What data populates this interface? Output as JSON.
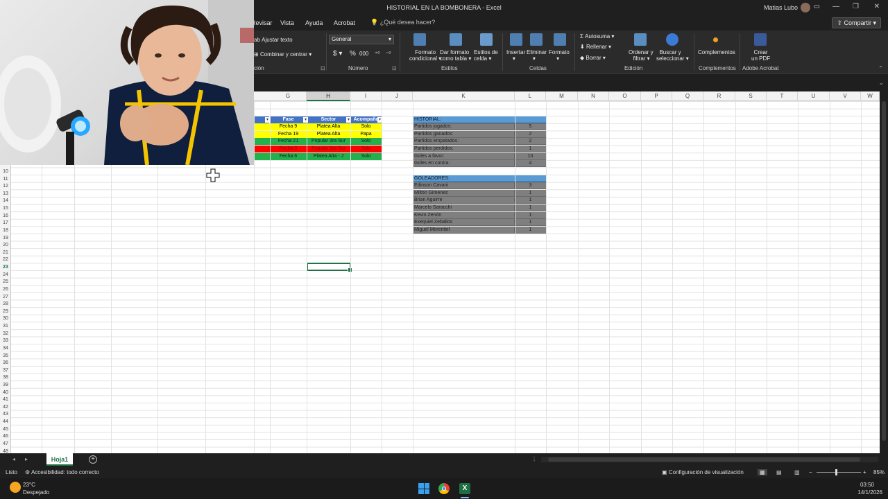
{
  "window": {
    "title": "HISTORIAL EN LA BOMBONERA  -  Excel",
    "user": "Matias Lubo"
  },
  "menu": {
    "items": [
      "Revisar",
      "Vista",
      "Ayuda",
      "Acrobat"
    ],
    "search_placeholder": "¿Qué desea hacer?",
    "share": "Compartir"
  },
  "ribbon": {
    "wrap_text": "Ajustar texto",
    "merge_center": "Combinar y centrar",
    "alignment_group_partial": "ción",
    "number_format": "General",
    "number_group": "Número",
    "styles": {
      "conditional": [
        "Formato",
        "condicional"
      ],
      "as_table": [
        "Dar formato",
        "como tabla"
      ],
      "cell_styles": [
        "Estilos de",
        "celda"
      ],
      "group": "Estilos"
    },
    "cells": {
      "insert": "Insertar",
      "delete": "Eliminar",
      "format": "Formato",
      "group": "Celdas"
    },
    "editing": {
      "autosum": "Autosuma",
      "fill": "Rellenar",
      "clear": "Borrar",
      "sort": [
        "Ordenar y",
        "filtrar"
      ],
      "find": [
        "Buscar y",
        "seleccionar"
      ],
      "group": "Edición"
    },
    "addins": {
      "label": "Complementos",
      "group": "Complementos"
    },
    "acrobat": {
      "label": [
        "Crear",
        "un PDF"
      ],
      "group": "Adobe Acrobat"
    }
  },
  "columns": [
    "G",
    "H",
    "I",
    "J",
    "K",
    "L",
    "M",
    "N",
    "O",
    "P",
    "Q",
    "R",
    "S",
    "T",
    "U",
    "V",
    "W"
  ],
  "selected_column": "H",
  "rows": {
    "first_visible": 10,
    "last_visible": 48,
    "selected": 23
  },
  "table": {
    "headers": [
      "Fase",
      "Sector",
      "Acompaña"
    ],
    "rows": [
      {
        "fase": "Fecha 9",
        "sector": "Platea Alta",
        "acomp": "Solo",
        "color": "#ffff00"
      },
      {
        "fase": "Fecha 19",
        "sector": "Platea Alta",
        "acomp": "Papa",
        "color": "#ffff00"
      },
      {
        "fase": "Fecha 21",
        "sector": "Popular 3ra Sur",
        "acomp": "Solo",
        "color": "#22b14c"
      },
      {
        "fase": "Fecha 3",
        "sector": "Popular 3ra Sur",
        "acomp": "Solo",
        "color": "#ff0000"
      },
      {
        "fase": "Fecha 6",
        "sector": "Platea Alta - J",
        "acomp": "Solo",
        "color": "#22b14c"
      }
    ]
  },
  "historial": {
    "title": "HISTORIAL:",
    "rows": [
      {
        "label": "Partidos jugados:",
        "value": "5"
      },
      {
        "label": "Partidos ganados:",
        "value": "2"
      },
      {
        "label": "Partidos empatados:",
        "value": "2"
      },
      {
        "label": "Partidos perdidos:",
        "value": "1"
      },
      {
        "label": "Goles a favor:",
        "value": "10"
      },
      {
        "label": "Goles en contra:",
        "value": "4"
      }
    ]
  },
  "goleadores": {
    "title": "GOLEADORES:",
    "rows": [
      {
        "name": "Edinson Cavani",
        "goals": "3"
      },
      {
        "name": "Milton Gimenez",
        "goals": "1"
      },
      {
        "name": "Brian Aguirre",
        "goals": "1"
      },
      {
        "name": "Marcelo Saracchi",
        "goals": "1"
      },
      {
        "name": "Kevin Zenón",
        "goals": "1"
      },
      {
        "name": "Exequiel Zeballos",
        "goals": "1"
      },
      {
        "name": "Miguel Merentiel",
        "goals": "1"
      }
    ]
  },
  "sheet_tab": "Hoja1",
  "status": {
    "ready": "Listo",
    "accessibility": "Accesibilidad: todo correcto",
    "display_settings": "Configuración de visualización",
    "zoom": "85%",
    "zoom_level": 0.85
  },
  "taskbar": {
    "temp": "23°C",
    "weather": "Despejado",
    "time": "03:50",
    "date": "14/1/2026"
  },
  "colors": {
    "excel_green": "#217346",
    "header_blue": "#5b9bd5",
    "box_gray": "#7f7f7f"
  }
}
